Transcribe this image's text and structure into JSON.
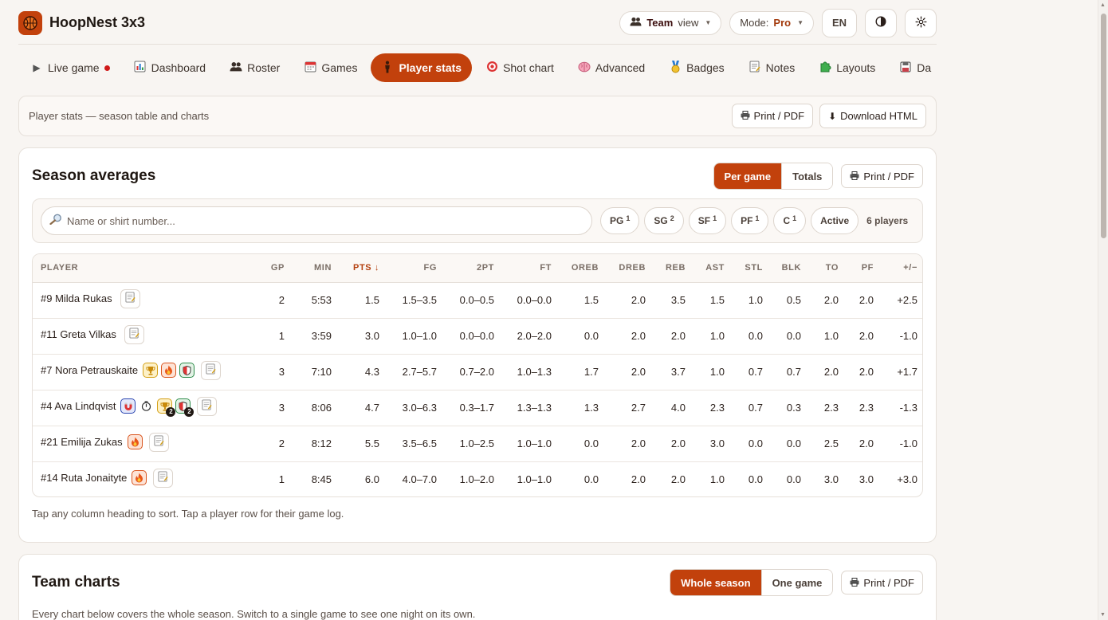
{
  "app": {
    "name": "HoopNest 3x3"
  },
  "header": {
    "team_strong": "Team",
    "team_view": "view",
    "mode_label": "Mode:",
    "mode_value": "Pro",
    "lang": "EN"
  },
  "nav": {
    "tabs": [
      {
        "label": "Live game",
        "icon": "play-icon"
      },
      {
        "label": "Dashboard",
        "icon": "bar-chart-icon"
      },
      {
        "label": "Roster",
        "icon": "people-icon"
      },
      {
        "label": "Games",
        "icon": "calendar-icon"
      },
      {
        "label": "Player stats",
        "icon": "player-icon",
        "active": true
      },
      {
        "label": "Shot chart",
        "icon": "target-icon"
      },
      {
        "label": "Advanced",
        "icon": "brain-icon"
      },
      {
        "label": "Badges",
        "icon": "medal-icon"
      },
      {
        "label": "Notes",
        "icon": "memo-icon"
      },
      {
        "label": "Layouts",
        "icon": "puzzle-icon"
      },
      {
        "label": "Da",
        "icon": "floppy-icon"
      }
    ]
  },
  "subbar": {
    "text": "Player stats — season table and charts",
    "print_label": "Print / PDF",
    "download_label": "Download HTML"
  },
  "season": {
    "title": "Season averages",
    "toggle": {
      "per_game": "Per game",
      "totals": "Totals"
    },
    "print_label": "Print / PDF",
    "search_placeholder": "Name or shirt number...",
    "positions": [
      {
        "label": "PG",
        "count": "1"
      },
      {
        "label": "SG",
        "count": "2"
      },
      {
        "label": "SF",
        "count": "1"
      },
      {
        "label": "PF",
        "count": "1"
      },
      {
        "label": "C",
        "count": "1"
      }
    ],
    "active_label": "Active",
    "player_count": "6 players",
    "columns": [
      "PLAYER",
      "GP",
      "MIN",
      "PTS ↓",
      "FG",
      "2PT",
      "FT",
      "OREB",
      "DREB",
      "REB",
      "AST",
      "STL",
      "BLK",
      "TO",
      "PF",
      "+/−"
    ],
    "rows": [
      {
        "player": "#9 Milda Rukas",
        "badges": [],
        "stats": [
          "2",
          "5:53",
          "1.5",
          "1.5–3.5",
          "0.0–0.5",
          "0.0–0.0",
          "1.5",
          "2.0",
          "3.5",
          "1.5",
          "1.0",
          "0.5",
          "2.0",
          "2.0",
          "+2.5"
        ]
      },
      {
        "player": "#11 Greta Vilkas",
        "badges": [],
        "stats": [
          "1",
          "3:59",
          "3.0",
          "1.0–1.0",
          "0.0–0.0",
          "2.0–2.0",
          "0.0",
          "2.0",
          "2.0",
          "1.0",
          "0.0",
          "0.0",
          "1.0",
          "2.0",
          "-1.0"
        ]
      },
      {
        "player": "#7 Nora Petrauskaite",
        "badges": [
          {
            "type": "trophy"
          },
          {
            "type": "fire"
          },
          {
            "type": "shield"
          }
        ],
        "stats": [
          "3",
          "7:10",
          "4.3",
          "2.7–5.7",
          "0.7–2.0",
          "1.0–1.3",
          "1.7",
          "2.0",
          "3.7",
          "1.0",
          "0.7",
          "0.7",
          "2.0",
          "2.0",
          "+1.7"
        ]
      },
      {
        "player": "#4 Ava Lindqvist",
        "badges": [
          {
            "type": "magnet"
          },
          {
            "type": "clock"
          },
          {
            "type": "trophy",
            "count": "2"
          },
          {
            "type": "shield",
            "count": "2"
          }
        ],
        "stats": [
          "3",
          "8:06",
          "4.7",
          "3.0–6.3",
          "0.3–1.7",
          "1.3–1.3",
          "1.3",
          "2.7",
          "4.0",
          "2.3",
          "0.7",
          "0.3",
          "2.3",
          "2.3",
          "-1.3"
        ]
      },
      {
        "player": "#21 Emilija Zukas",
        "badges": [
          {
            "type": "fire"
          }
        ],
        "stats": [
          "2",
          "8:12",
          "5.5",
          "3.5–6.5",
          "1.0–2.5",
          "1.0–1.0",
          "0.0",
          "2.0",
          "2.0",
          "3.0",
          "0.0",
          "0.0",
          "2.5",
          "2.0",
          "-1.0"
        ]
      },
      {
        "player": "#14 Ruta Jonaityte",
        "badges": [
          {
            "type": "fire"
          }
        ],
        "stats": [
          "1",
          "8:45",
          "6.0",
          "4.0–7.0",
          "1.0–2.0",
          "1.0–1.0",
          "0.0",
          "2.0",
          "2.0",
          "1.0",
          "0.0",
          "0.0",
          "3.0",
          "3.0",
          "+3.0"
        ]
      }
    ],
    "hint": "Tap any column heading to sort. Tap a player row for their game log."
  },
  "charts": {
    "title": "Team charts",
    "toggle": {
      "whole": "Whole season",
      "one": "One game"
    },
    "print_label": "Print / PDF",
    "subtitle": "Every chart below covers the whole season. Switch to a single game to see one night on its own."
  },
  "colors": {
    "accent": "#c2410c",
    "live_dot": "#d01919",
    "background": "#f8f5f2"
  }
}
